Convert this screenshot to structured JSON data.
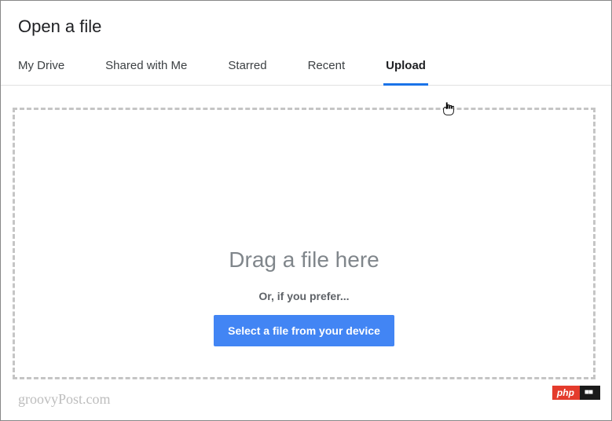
{
  "modal": {
    "title": "Open a file"
  },
  "tabs": {
    "items": [
      {
        "label": "My Drive",
        "active": false
      },
      {
        "label": "Shared with Me",
        "active": false
      },
      {
        "label": "Starred",
        "active": false
      },
      {
        "label": "Recent",
        "active": false
      },
      {
        "label": "Upload",
        "active": true
      }
    ]
  },
  "dropzone": {
    "drag_text": "Drag a file here",
    "or_text": "Or, if you prefer...",
    "button_label": "Select a file from your device"
  },
  "watermark": {
    "text": "groovyPost.com"
  },
  "badges": {
    "php": "php",
    "dark": "■■"
  },
  "colors": {
    "accent": "#1a73e8",
    "button": "#4285f4",
    "badge_red": "#e43b2c"
  }
}
